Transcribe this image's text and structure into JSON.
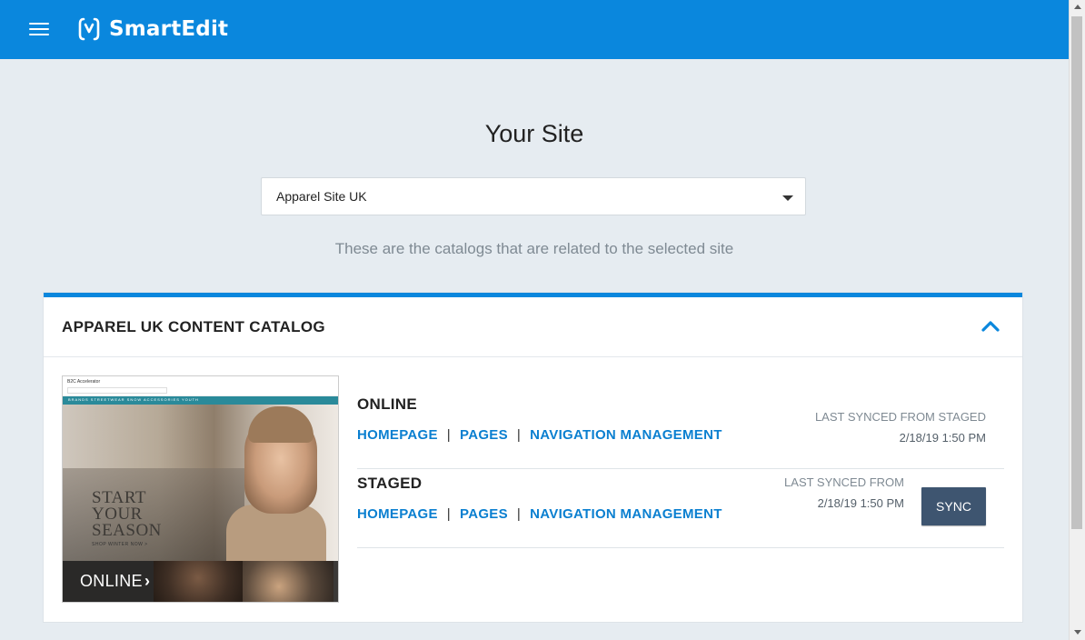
{
  "header": {
    "app_name": "SmartEdit",
    "menu_icon": "hamburger-icon",
    "logo_icon": "smartedit-logo-icon",
    "background_color": "#0a87dd"
  },
  "site": {
    "title": "Your Site",
    "selected_site": "Apparel Site UK",
    "subtitle": "These are the catalogs that are related to the selected site"
  },
  "catalog": {
    "name": "APPAREL UK CONTENT CATALOG",
    "collapse_icon": "chevron-up-icon",
    "thumbnail": {
      "overlay_label": "ONLINE",
      "overlay_icon": "chevron-right-icon",
      "hero_text": "START YOUR SEASON",
      "hero_cta": "SHOP WINTER NOW >",
      "site_logo": "B2C Accelerator",
      "search_placeholder": "I'm looking for",
      "nav_text": "BRANDS  STREETWEAR  SNOW  ACCESSORIES  YOUTH"
    },
    "versions": [
      {
        "name": "ONLINE",
        "links": [
          "HOMEPAGE",
          "PAGES",
          "NAVIGATION MANAGEMENT"
        ],
        "sync_label": "LAST SYNCED FROM STAGED",
        "sync_date": "2/18/19 1:50 PM"
      },
      {
        "name": "STAGED",
        "links": [
          "HOMEPAGE",
          "PAGES",
          "NAVIGATION MANAGEMENT"
        ],
        "sync_label": "LAST SYNCED FROM",
        "sync_date": "2/18/19 1:50 PM",
        "sync_button": "SYNC"
      }
    ],
    "link_separator": "|"
  },
  "colors": {
    "accent": "#0a87dd",
    "link": "#0a7fd0",
    "sync_button": "#3e5570"
  }
}
